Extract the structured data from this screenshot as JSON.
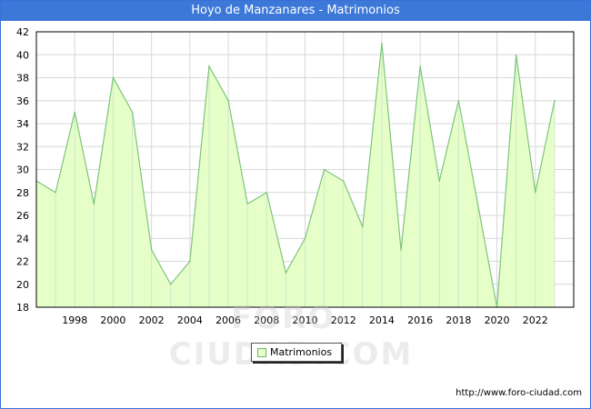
{
  "title": "Hoyo de Manzanares - Matrimonios",
  "watermark": "FORO-CIUDAD.COM",
  "source_url": "http://www.foro-ciudad.com",
  "colors": {
    "title_bg": "#3c78d8",
    "area_fill": "#e6ffc8",
    "line": "#7cc47c",
    "grid": "#d8d8d8"
  },
  "chart_data": {
    "type": "area",
    "title": "Hoyo de Manzanares - Matrimonios",
    "xlabel": "",
    "ylabel": "",
    "x": [
      1996,
      1997,
      1998,
      1999,
      2000,
      2001,
      2002,
      2003,
      2004,
      2005,
      2006,
      2007,
      2008,
      2009,
      2010,
      2011,
      2012,
      2013,
      2014,
      2015,
      2016,
      2017,
      2018,
      2019,
      2020,
      2021,
      2022,
      2023
    ],
    "series": [
      {
        "name": "Matrimonios",
        "values": [
          29,
          28,
          35,
          27,
          38,
          35,
          23,
          20,
          22,
          39,
          36,
          27,
          28,
          21,
          24,
          30,
          29,
          25,
          41,
          23,
          39,
          29,
          36,
          27,
          18,
          40,
          28,
          36
        ]
      }
    ],
    "xlim": [
      1996,
      2024
    ],
    "ylim": [
      18,
      42
    ],
    "xticks": [
      "1998",
      "2000",
      "2002",
      "2004",
      "2006",
      "2008",
      "2010",
      "2012",
      "2014",
      "2016",
      "2018",
      "2020",
      "2022"
    ],
    "yticks": [
      "18",
      "20",
      "22",
      "24",
      "26",
      "28",
      "30",
      "32",
      "34",
      "36",
      "38",
      "40",
      "42"
    ],
    "grid": true,
    "legend": "bottom-center"
  }
}
